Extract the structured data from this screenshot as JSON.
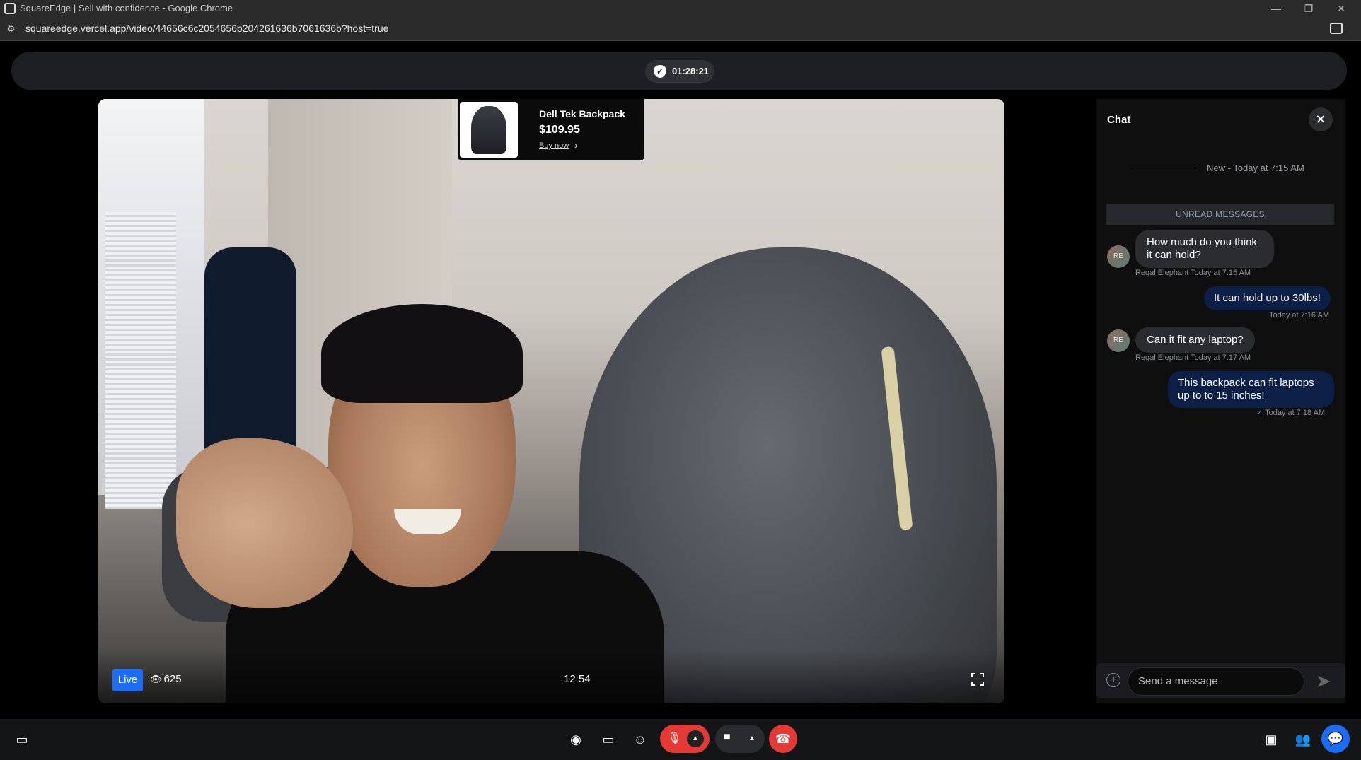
{
  "browser": {
    "window_title": "SquareEdge | Sell with confidence - Google Chrome",
    "url": "squareedge.vercel.app/video/44656c6c2054656b204261636b7061636b?host=true",
    "controls": {
      "minimize": "—",
      "restore": "❐",
      "close": "✕"
    }
  },
  "topbar": {
    "timer": "01:28:21",
    "timer_icon": "shield-check-icon"
  },
  "product": {
    "name": "Dell Tek Backpack",
    "price": "$109.95",
    "buy_label": "Buy now",
    "chevron": "›"
  },
  "video": {
    "live_label": "Live",
    "viewer_icon": "👁",
    "viewers": "625",
    "elapsed": "12:54"
  },
  "chat": {
    "title": "Chat",
    "close_glyph": "✕",
    "new_divider": "New - Today at 7:15 AM",
    "unread_label": "UNREAD MESSAGES",
    "messages": [
      {
        "from": "Regal Elephant",
        "avatar": "RE",
        "text_line1": "How much do you think",
        "text_line2": "it can hold?",
        "meta": "Regal Elephant Today at 7:15 AM"
      },
      {
        "from": "host",
        "text": "It can hold up to 30lbs!",
        "meta": "Today at 7:16 AM"
      },
      {
        "from": "Regal Elephant",
        "avatar": "RE",
        "text": "Can it fit any laptop?",
        "meta": "Regal Elephant Today at 7:17 AM"
      },
      {
        "from": "host",
        "text_line1": "This backpack can fit laptops",
        "text_line2": "up to to 15 inches!",
        "meta": "Today at 7:18 AM",
        "read_glyph": "✓"
      }
    ],
    "composer": {
      "placeholder": "Send a message",
      "plus_glyph": "+",
      "send_glyph": "➤"
    }
  },
  "bottombar": {
    "icons": {
      "present": "▭",
      "record": "◉",
      "screen_share": "▭",
      "reaction": "☺",
      "mic_off": "🎙",
      "caret": "▲",
      "camera": "■",
      "leave": "☎",
      "media": "▣",
      "participants": "👥",
      "chat": "💬"
    }
  }
}
